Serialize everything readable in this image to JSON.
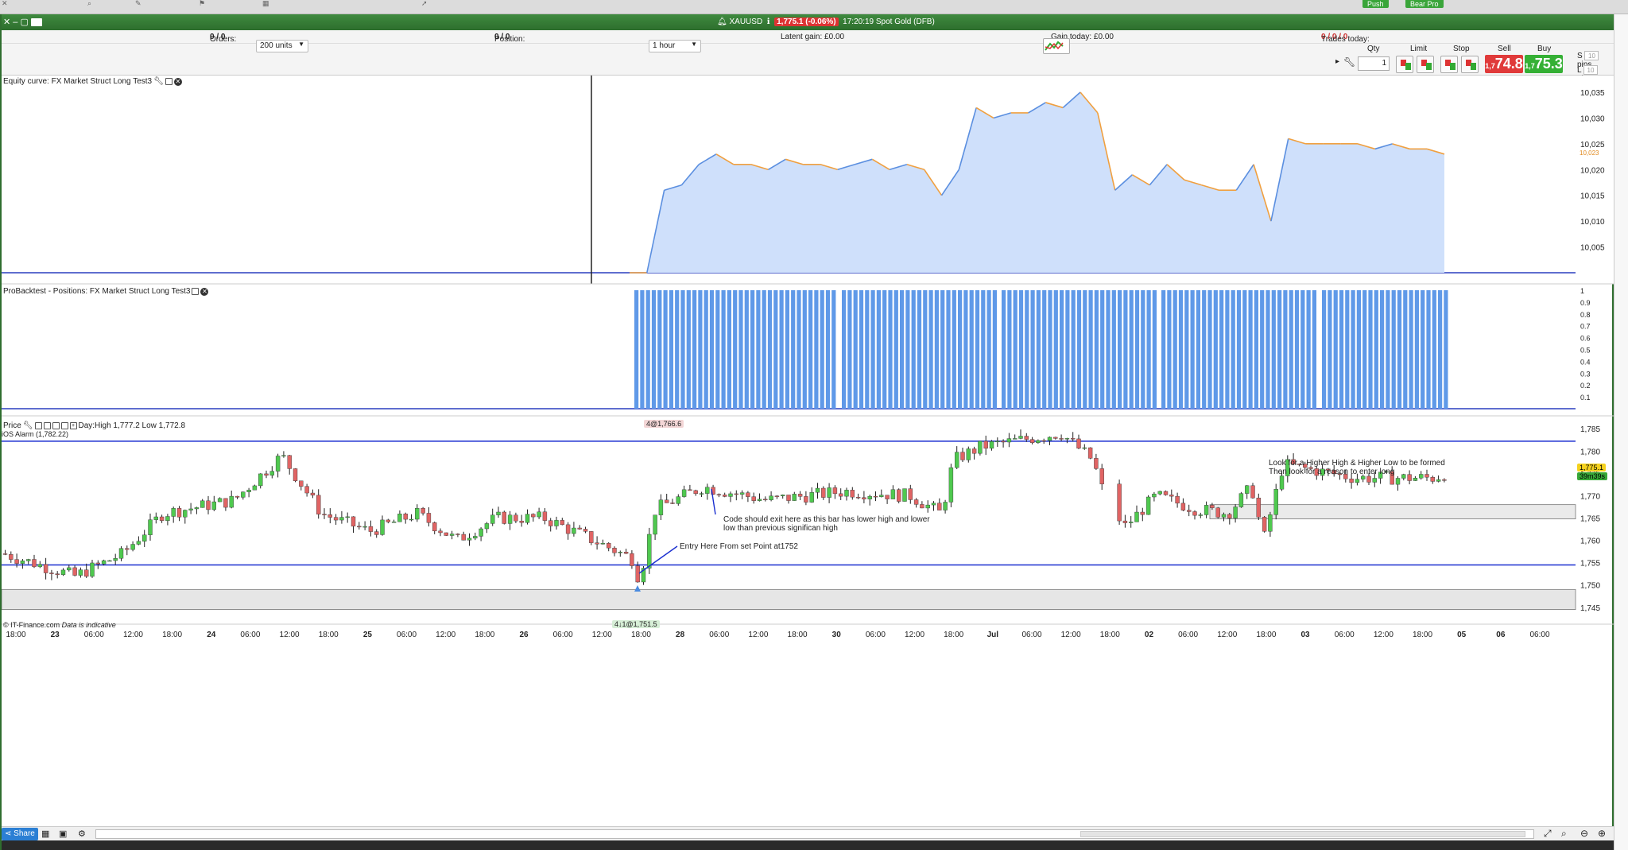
{
  "window": {
    "instrument": "XAUUSD",
    "price_badge": "1,775.1 (-0.06%)",
    "time": "17:20:19",
    "market_name": "Spot Gold (DFB)"
  },
  "top_buttons": {
    "push": "Push",
    "bear_pro": "Bear Pro"
  },
  "info": {
    "orders_label": "Orders:",
    "orders_value": "0 / 0",
    "position_label": "Position:",
    "position_value": "0 / 0",
    "latent_gain": "Latent gain: £0.00",
    "gain_today": "Gain today: £0.00",
    "trades_today_label": "Trades today:",
    "trades_today_value": "0 / 0 / 0"
  },
  "controls": {
    "units_select": "200 units",
    "timeframe_select": "1 hour",
    "qty_label": "Qty",
    "qty_value": "1",
    "limit_label": "Limit",
    "stop_label": "Stop",
    "sell_label": "Sell",
    "buy_label": "Buy",
    "sell_small": "1,7",
    "sell_big": "74.8",
    "buy_small": "1,7",
    "buy_big": "75.3",
    "s_label": "S",
    "l_label": "L",
    "pips_value": "10",
    "pips_label": "pips"
  },
  "equity_panel": {
    "title": "Equity curve: FX Market Struct Long Test3",
    "y_ticks": [
      "10,035",
      "10,030",
      "10,025",
      "10,020",
      "10,015",
      "10,010",
      "10,005"
    ],
    "current_tag": "10,023"
  },
  "positions_panel": {
    "title": "ProBacktest - Positions: FX Market Struct Long Test3",
    "y_ticks": [
      "1",
      "0.9",
      "0.8",
      "0.7",
      "0.6",
      "0.5",
      "0.4",
      "0.3",
      "0.2",
      "0.1"
    ]
  },
  "price_panel": {
    "title": "Price",
    "day_range": "Day:High 1,777.2 Low 1,772.8",
    "alarm_label": "iOS Alarm (1,782.22)",
    "order_tag": "4@1,766.6",
    "entry_tag": "4↓1@1,751.5",
    "y_ticks": [
      "1,785",
      "1,780",
      "1,775",
      "1,770",
      "1,765",
      "1,760",
      "1,755",
      "1,750",
      "1,745"
    ],
    "price_tag": "1,775.1",
    "countdown_tag": "39m39s",
    "copyright": "© IT-Finance.com",
    "indicative": "Data is indicative",
    "annotations": {
      "exit_note_line1": "Code should exit here as this bar has lower high and lower",
      "exit_note_line2": "low than previous significan high",
      "entry_note": "Entry Here From set Point at1752",
      "higher_high_line1": "Look for a Higher High & Higher Low to be formed",
      "higher_high_line2": "Then look for a reason to enter long"
    }
  },
  "x_axis": {
    "labels": [
      "18:00",
      "23",
      "06:00",
      "12:00",
      "18:00",
      "24",
      "06:00",
      "12:00",
      "18:00",
      "25",
      "06:00",
      "12:00",
      "18:00",
      "26",
      "06:00",
      "12:00",
      "18:00",
      "28",
      "06:00",
      "12:00",
      "18:00",
      "30",
      "06:00",
      "12:00",
      "18:00",
      "Jul",
      "06:00",
      "12:00",
      "18:00",
      "02",
      "06:00",
      "12:00",
      "18:00",
      "03",
      "06:00",
      "12:00",
      "18:00",
      "05",
      "06",
      "06:00"
    ]
  },
  "bottom": {
    "share_label": "Share"
  },
  "chart_data": {
    "type": "line",
    "description_series": [
      {
        "name": "Equity curve",
        "values": [
          10000,
          10000,
          10016,
          10017,
          10021,
          10023,
          10021,
          10021,
          10020,
          10022,
          10021,
          10021,
          10020,
          10021,
          10022,
          10020,
          10021,
          10020,
          10015,
          10020,
          10032,
          10030,
          10031,
          10031,
          10033,
          10032,
          10035,
          10031,
          10016,
          10019,
          10017,
          10021,
          10018,
          10017,
          10016,
          10016,
          10021,
          10010,
          10026,
          10025,
          10025,
          10025,
          10025,
          10024,
          10025,
          10024,
          10024,
          10023
        ]
      }
    ],
    "equity_ylim": [
      10000,
      10037
    ],
    "price_ylim": [
      1743,
      1787
    ],
    "price_levels": {
      "alarm": 1782.22,
      "entry_level": 1754.5
    },
    "grid": false
  }
}
